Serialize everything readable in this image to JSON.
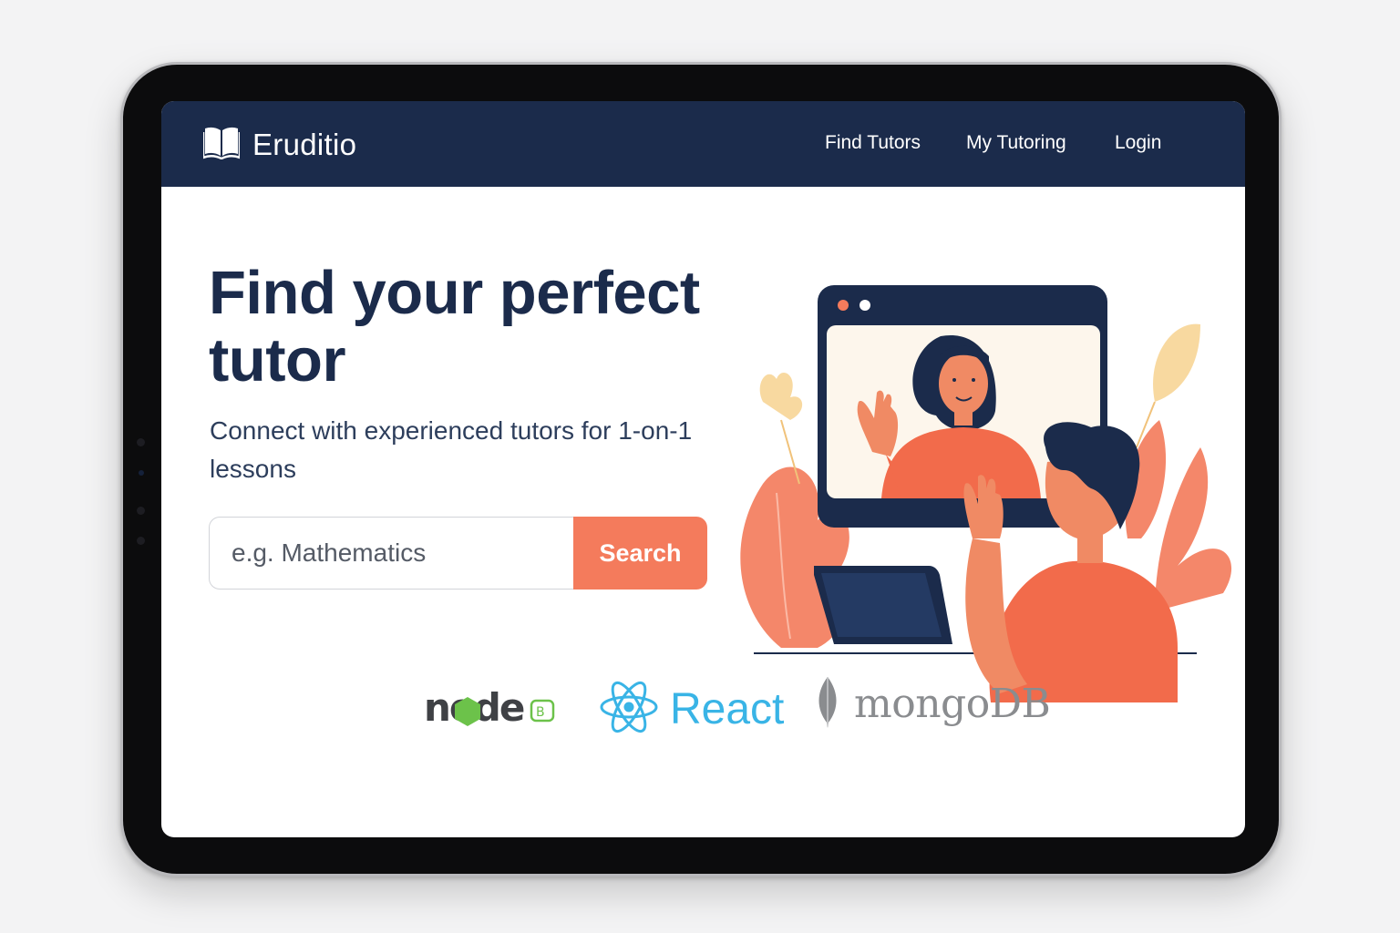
{
  "brand": {
    "name": "Eruditio",
    "icon": "open-book-icon"
  },
  "nav": {
    "links": [
      {
        "label": "Find Tutors"
      },
      {
        "label": "My Tutoring"
      },
      {
        "label": "Login"
      }
    ]
  },
  "hero": {
    "title": "Find your perfect tutor",
    "subtitle": "Connect with experienced tutors for 1-on-1 lessons"
  },
  "search": {
    "placeholder": "e.g. Mathematics",
    "button_label": "Search"
  },
  "tech_logos": {
    "node": "node",
    "react": "React",
    "mongo": "mongoDB"
  },
  "colors": {
    "navbar": "#1b2b4b",
    "accent": "#f47b5c",
    "heading": "#1b2b4b",
    "react": "#39b4e6",
    "node_green": "#6cc24a",
    "mongo_gray": "#8a8c8f"
  }
}
